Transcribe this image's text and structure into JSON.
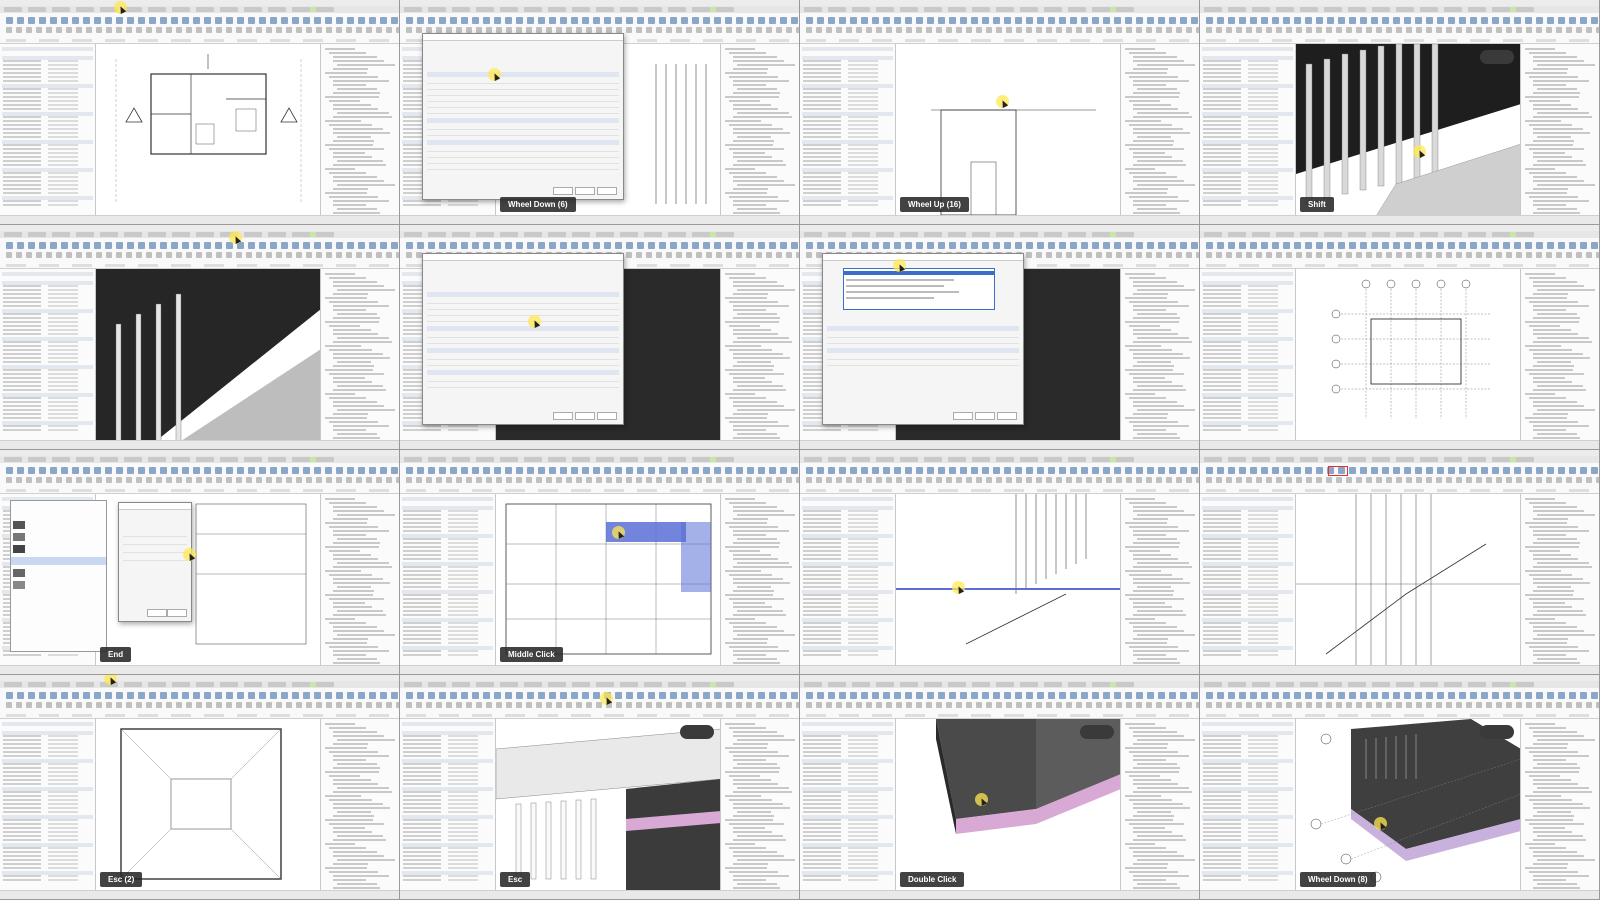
{
  "tiles": [
    {
      "id": 1,
      "key_label": "",
      "scene": "floor-plan"
    },
    {
      "id": 2,
      "key_label": "Wheel Down (6)",
      "scene": "type-properties-dialog"
    },
    {
      "id": 3,
      "key_label": "Wheel Up (16)",
      "scene": "section-view"
    },
    {
      "id": 4,
      "key_label": "Shift",
      "scene": "3d-railing"
    },
    {
      "id": 5,
      "key_label": "",
      "scene": "3d-railing-properties"
    },
    {
      "id": 6,
      "key_label": "",
      "scene": "type-properties-dialog-2"
    },
    {
      "id": 7,
      "key_label": "",
      "scene": "type-dropdown-dialog"
    },
    {
      "id": 8,
      "key_label": "",
      "scene": "grid-plan"
    },
    {
      "id": 9,
      "key_label": "End",
      "scene": "edit-rail-structure"
    },
    {
      "id": 10,
      "key_label": "Middle Click",
      "scene": "plan-highlight"
    },
    {
      "id": 11,
      "key_label": "",
      "scene": "stair-section"
    },
    {
      "id": 12,
      "key_label": "",
      "scene": "stair-section-2"
    },
    {
      "id": 13,
      "key_label": "Esc (2)",
      "scene": "plan-outline"
    },
    {
      "id": 14,
      "key_label": "Esc",
      "scene": "3d-facade"
    },
    {
      "id": 15,
      "key_label": "Double Click",
      "scene": "3d-corner"
    },
    {
      "id": 16,
      "key_label": "Wheel Down (8)",
      "scene": "3d-building"
    }
  ],
  "colors": {
    "cursor_highlight": "#ffe850",
    "selection_blue": "#5a6fd6",
    "active_context_tab": "#c6e8a4"
  }
}
